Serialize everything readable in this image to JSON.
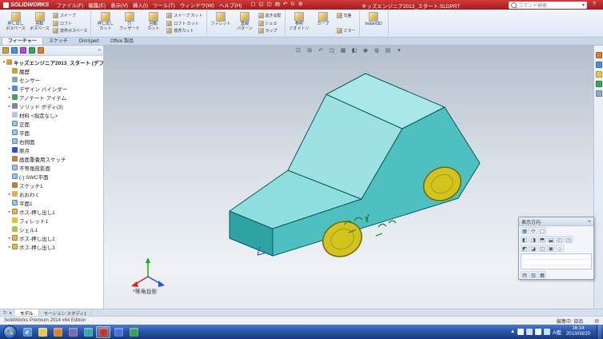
{
  "title_bar": {
    "app_name": "SOLIDWORKS",
    "menus": [
      "ファイル(F)",
      "編集(E)",
      "表示(V)",
      "挿入(I)",
      "ツール(T)",
      "ウィンドウ(W)",
      "ヘルプ(H)"
    ],
    "quick_toolbar": [
      {
        "name": "new",
        "glyph": "▢"
      },
      {
        "name": "open",
        "glyph": "◱"
      },
      {
        "name": "save",
        "glyph": "◫"
      },
      {
        "name": "print",
        "glyph": "▤"
      },
      {
        "name": "undo",
        "glyph": "↶"
      },
      {
        "name": "rebuild",
        "glyph": "↻"
      },
      {
        "name": "options",
        "glyph": "⚙"
      }
    ],
    "document_title": "キッズエンジニア2013_スタート.SLDPRT",
    "search_placeholder": "コマンド検索",
    "help_label": "?"
  },
  "ribbon": {
    "groups": [
      {
        "buttons": [
          {
            "label": "押し出し\nボスベース",
            "name": "extruded-boss-base"
          },
          {
            "label": "回転\nボスベース",
            "name": "revolved-boss-base"
          }
        ],
        "stack": [
          {
            "label": "スイープ",
            "name": "swept-boss"
          },
          {
            "label": "ロフト",
            "name": "lofted-boss"
          },
          {
            "label": "境界ボスベース",
            "name": "boundary-boss"
          }
        ]
      },
      {
        "buttons": [
          {
            "label": "押し出し\nカット",
            "name": "extruded-cut"
          },
          {
            "label": "穴\nウィザード",
            "name": "hole-wizard"
          },
          {
            "label": "回転\nカット",
            "name": "revolved-cut"
          }
        ],
        "stack": [
          {
            "label": "スイープ カット",
            "name": "swept-cut"
          },
          {
            "label": "ロフト カット",
            "name": "lofted-cut"
          },
          {
            "label": "境界カット",
            "name": "boundary-cut"
          }
        ]
      },
      {
        "buttons": [
          {
            "label": "フィレット",
            "name": "fillet"
          },
          {
            "label": "直線\nパターン",
            "name": "linear-pattern"
          }
        ],
        "stack": [
          {
            "label": "抜き勾配",
            "name": "draft"
          },
          {
            "label": "シェル",
            "name": "shell"
          },
          {
            "label": "ラップ",
            "name": "wrap"
          }
        ]
      },
      {
        "buttons": [
          {
            "label": "参照\nジオメトリ",
            "name": "reference-geometry"
          },
          {
            "label": "カーブ",
            "name": "curves"
          }
        ],
        "stack": [
          {
            "label": "交差",
            "name": "intersect"
          },
          {
            "label": "ミラー",
            "name": "mirror"
          }
        ]
      },
      {
        "buttons": [
          {
            "label": "Instant3D",
            "name": "instant3d"
          }
        ],
        "stack": []
      }
    ],
    "tabs": [
      {
        "label": "フィーチャー",
        "name": "features",
        "active": true
      },
      {
        "label": "スケッチ",
        "name": "sketch",
        "active": false
      },
      {
        "label": "DimXpert",
        "name": "dimxpert",
        "active": false
      },
      {
        "label": "Office 製品",
        "name": "office-products",
        "active": false
      }
    ]
  },
  "feature_manager": {
    "panel_tabs": [
      {
        "name": "featuremanager-tree",
        "color": "#caa53a"
      },
      {
        "name": "propertymanager",
        "color": "#4a90d9"
      },
      {
        "name": "configurationmanager",
        "color": "#b04ad9"
      },
      {
        "name": "dimxpertmanager",
        "color": "#3aa65a"
      },
      {
        "name": "displaymanager",
        "color": "#d9822b"
      }
    ],
    "root_label": "キッズエンジニア2013_スタート (デフォルト)",
    "items": [
      {
        "label": "履歴",
        "icon": "history",
        "expand": false
      },
      {
        "label": "センサー",
        "icon": "sensor",
        "expand": false
      },
      {
        "label": "デザイン バインダー",
        "icon": "binder",
        "expand": true
      },
      {
        "label": "アノテート アイテム",
        "icon": "annot",
        "expand": true
      },
      {
        "label": "ソリッド ボディ(3)",
        "icon": "solids",
        "expand": true
      },
      {
        "label": "材料 <指定なし>",
        "icon": "material",
        "expand": false
      },
      {
        "label": "正面",
        "icon": "plane",
        "expand": false
      },
      {
        "label": "平面",
        "icon": "plane",
        "expand": false
      },
      {
        "label": "右側面",
        "icon": "plane",
        "expand": false
      },
      {
        "label": "原点",
        "icon": "origin",
        "expand": false
      },
      {
        "label": "画面重畳用スケッチ",
        "icon": "sketch",
        "expand": false
      },
      {
        "label": "不等角投影面",
        "icon": "plane",
        "expand": false
      },
      {
        "label": "(-) SWC平面",
        "icon": "plane",
        "expand": false
      },
      {
        "label": "スケッチ1",
        "icon": "sketch",
        "expand": false
      },
      {
        "label": "おおわく",
        "icon": "feature",
        "expand": true
      },
      {
        "label": "平面1",
        "icon": "plane",
        "expand": false
      },
      {
        "label": "ボス-押し出し1",
        "icon": "extrude",
        "expand": true
      },
      {
        "label": "フィレット1",
        "icon": "fillet",
        "expand": false
      },
      {
        "label": "シェル1",
        "icon": "shell",
        "expand": false
      },
      {
        "label": "ボス-押し出し2",
        "icon": "extrude",
        "expand": true
      },
      {
        "label": "ボス-押し出し3",
        "icon": "extrude",
        "expand": true
      }
    ]
  },
  "viewport": {
    "view_label": "*等角投影",
    "headsup_icons": [
      {
        "name": "zoom-to-fit",
        "glyph": "⊡"
      },
      {
        "name": "zoom-to-area",
        "glyph": "⊞"
      },
      {
        "name": "previous-view",
        "glyph": "↶"
      },
      {
        "name": "section-view",
        "glyph": "◫"
      },
      {
        "name": "view-orientation",
        "glyph": "▦"
      },
      {
        "name": "display-style",
        "glyph": "◧"
      },
      {
        "name": "hide-show-items",
        "glyph": "◉"
      },
      {
        "name": "edit-appearance",
        "glyph": "◍"
      },
      {
        "name": "apply-scene",
        "glyph": "▤"
      },
      {
        "name": "view-settings",
        "glyph": "▾"
      }
    ],
    "colors": {
      "body_side": "#4fc0c0",
      "body_top": "#a8e8e8",
      "body_front": "#2ea3a3",
      "edge": "#0c5a5a",
      "wheel": "#d2c31e"
    }
  },
  "task_pane": {
    "icons": [
      {
        "name": "solidworks-resources",
        "color": "#d9822b"
      },
      {
        "name": "design-library",
        "color": "#4a90d9"
      },
      {
        "name": "file-explorer",
        "color": "#e8c84a"
      },
      {
        "name": "appearances-scenes",
        "color": "#3aa65a"
      },
      {
        "name": "custom-properties",
        "color": "#9aa7b8"
      }
    ]
  },
  "view_orientation_panel": {
    "title": "表示方向",
    "pin_glyph": "+",
    "toolbar": [
      {
        "name": "new-view",
        "glyph": "▦"
      },
      {
        "name": "update-standard-views",
        "glyph": "⟳"
      },
      {
        "name": "reset-standard-views",
        "glyph": "▢"
      }
    ],
    "views_row1": [
      {
        "name": "front-view",
        "glyph": "◧"
      },
      {
        "name": "back-view",
        "glyph": "◨"
      },
      {
        "name": "left-view",
        "glyph": "⬒"
      },
      {
        "name": "right-view",
        "glyph": "⬓"
      },
      {
        "name": "top-view",
        "glyph": "◰"
      },
      {
        "name": "bottom-view",
        "glyph": "◳"
      }
    ],
    "views_row2": [
      {
        "name": "isometric-view",
        "glyph": "◩"
      },
      {
        "name": "trimetric-view",
        "glyph": "◪"
      },
      {
        "name": "dimetric-view",
        "glyph": "◫"
      },
      {
        "name": "normal-to",
        "glyph": "▣"
      },
      {
        "name": "single-view",
        "glyph": "◇"
      }
    ],
    "bottom": [
      {
        "name": "one-viewport",
        "glyph": "▤"
      },
      {
        "name": "two-viewports",
        "glyph": "▥"
      },
      {
        "name": "four-viewports",
        "glyph": "▦"
      }
    ]
  },
  "model_tabs": {
    "icons": [
      {
        "name": "rebuild",
        "glyph": "↻"
      },
      {
        "name": "expand-tabs",
        "glyph": "▸"
      }
    ],
    "tabs": [
      {
        "label": "モデル",
        "name": "model",
        "active": true
      },
      {
        "label": "モーション スタディ1",
        "name": "motion-study-1",
        "active": false
      }
    ]
  },
  "status_bar": {
    "left": "SolidWorks Premium 2014 x64 Edition",
    "editing": "編集中: 部品",
    "icon_glyph": "▤"
  },
  "taskbar": {
    "icons": [
      {
        "name": "internet-explorer",
        "color": "#4a90d9",
        "glyph": "e"
      },
      {
        "name": "windows-explorer",
        "color": "#e8c84a",
        "glyph": ""
      },
      {
        "name": "media-player",
        "color": "#d9822b",
        "glyph": ""
      },
      {
        "name": "office-app",
        "color": "#7b68ae",
        "glyph": ""
      },
      {
        "name": "app-teal",
        "color": "#3aa6a6",
        "glyph": ""
      },
      {
        "name": "solidworks",
        "color": "#c0392b",
        "glyph": "",
        "pressed": true
      },
      {
        "name": "app-blue",
        "color": "#4a6fd9",
        "glyph": ""
      },
      {
        "name": "app-green",
        "color": "#3a9f5a",
        "glyph": ""
      }
    ],
    "tray": {
      "hidden_icons_glyph": "▲",
      "icons": [
        {
          "name": "action-center",
          "color": "#f0f4f8"
        },
        {
          "name": "network",
          "color": "#cfe0f0"
        },
        {
          "name": "volume",
          "color": "#f0f4f8"
        },
        {
          "name": "usb",
          "color": "#cfe0f0"
        }
      ],
      "ime": "A般",
      "time": "16:14",
      "date": "2013/09/20"
    }
  }
}
